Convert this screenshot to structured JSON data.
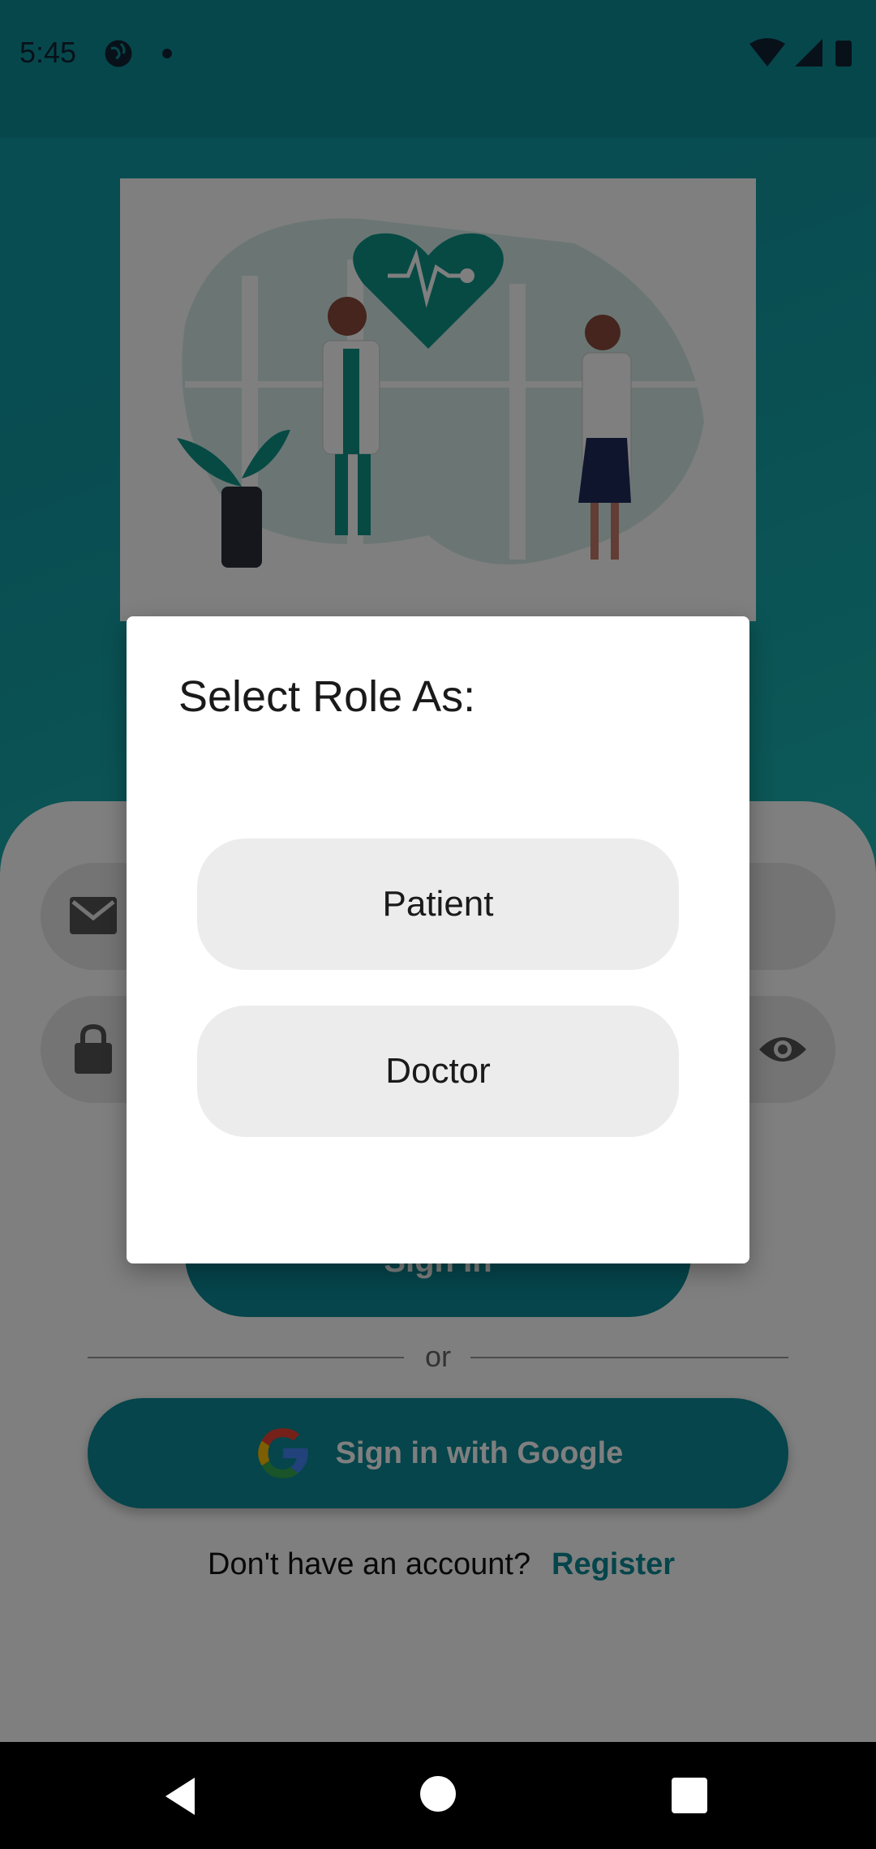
{
  "status_bar": {
    "time": "5:45"
  },
  "login": {
    "signin_label": "Sign In",
    "or_label": "or",
    "google_label": "Sign in with Google",
    "no_account_label": "Don't have an account?",
    "register_label": "Register"
  },
  "dialog": {
    "title": "Select Role As:",
    "options": [
      "Patient",
      "Doctor"
    ]
  },
  "colors": {
    "primary": "#0a8a97",
    "background_teal": "#129aa3"
  },
  "icons": [
    "globe-icon",
    "wifi-icon",
    "signal-icon",
    "battery-icon",
    "mail-icon",
    "lock-icon",
    "eye-icon",
    "google-icon",
    "back-icon",
    "home-icon",
    "recent-apps-icon"
  ]
}
